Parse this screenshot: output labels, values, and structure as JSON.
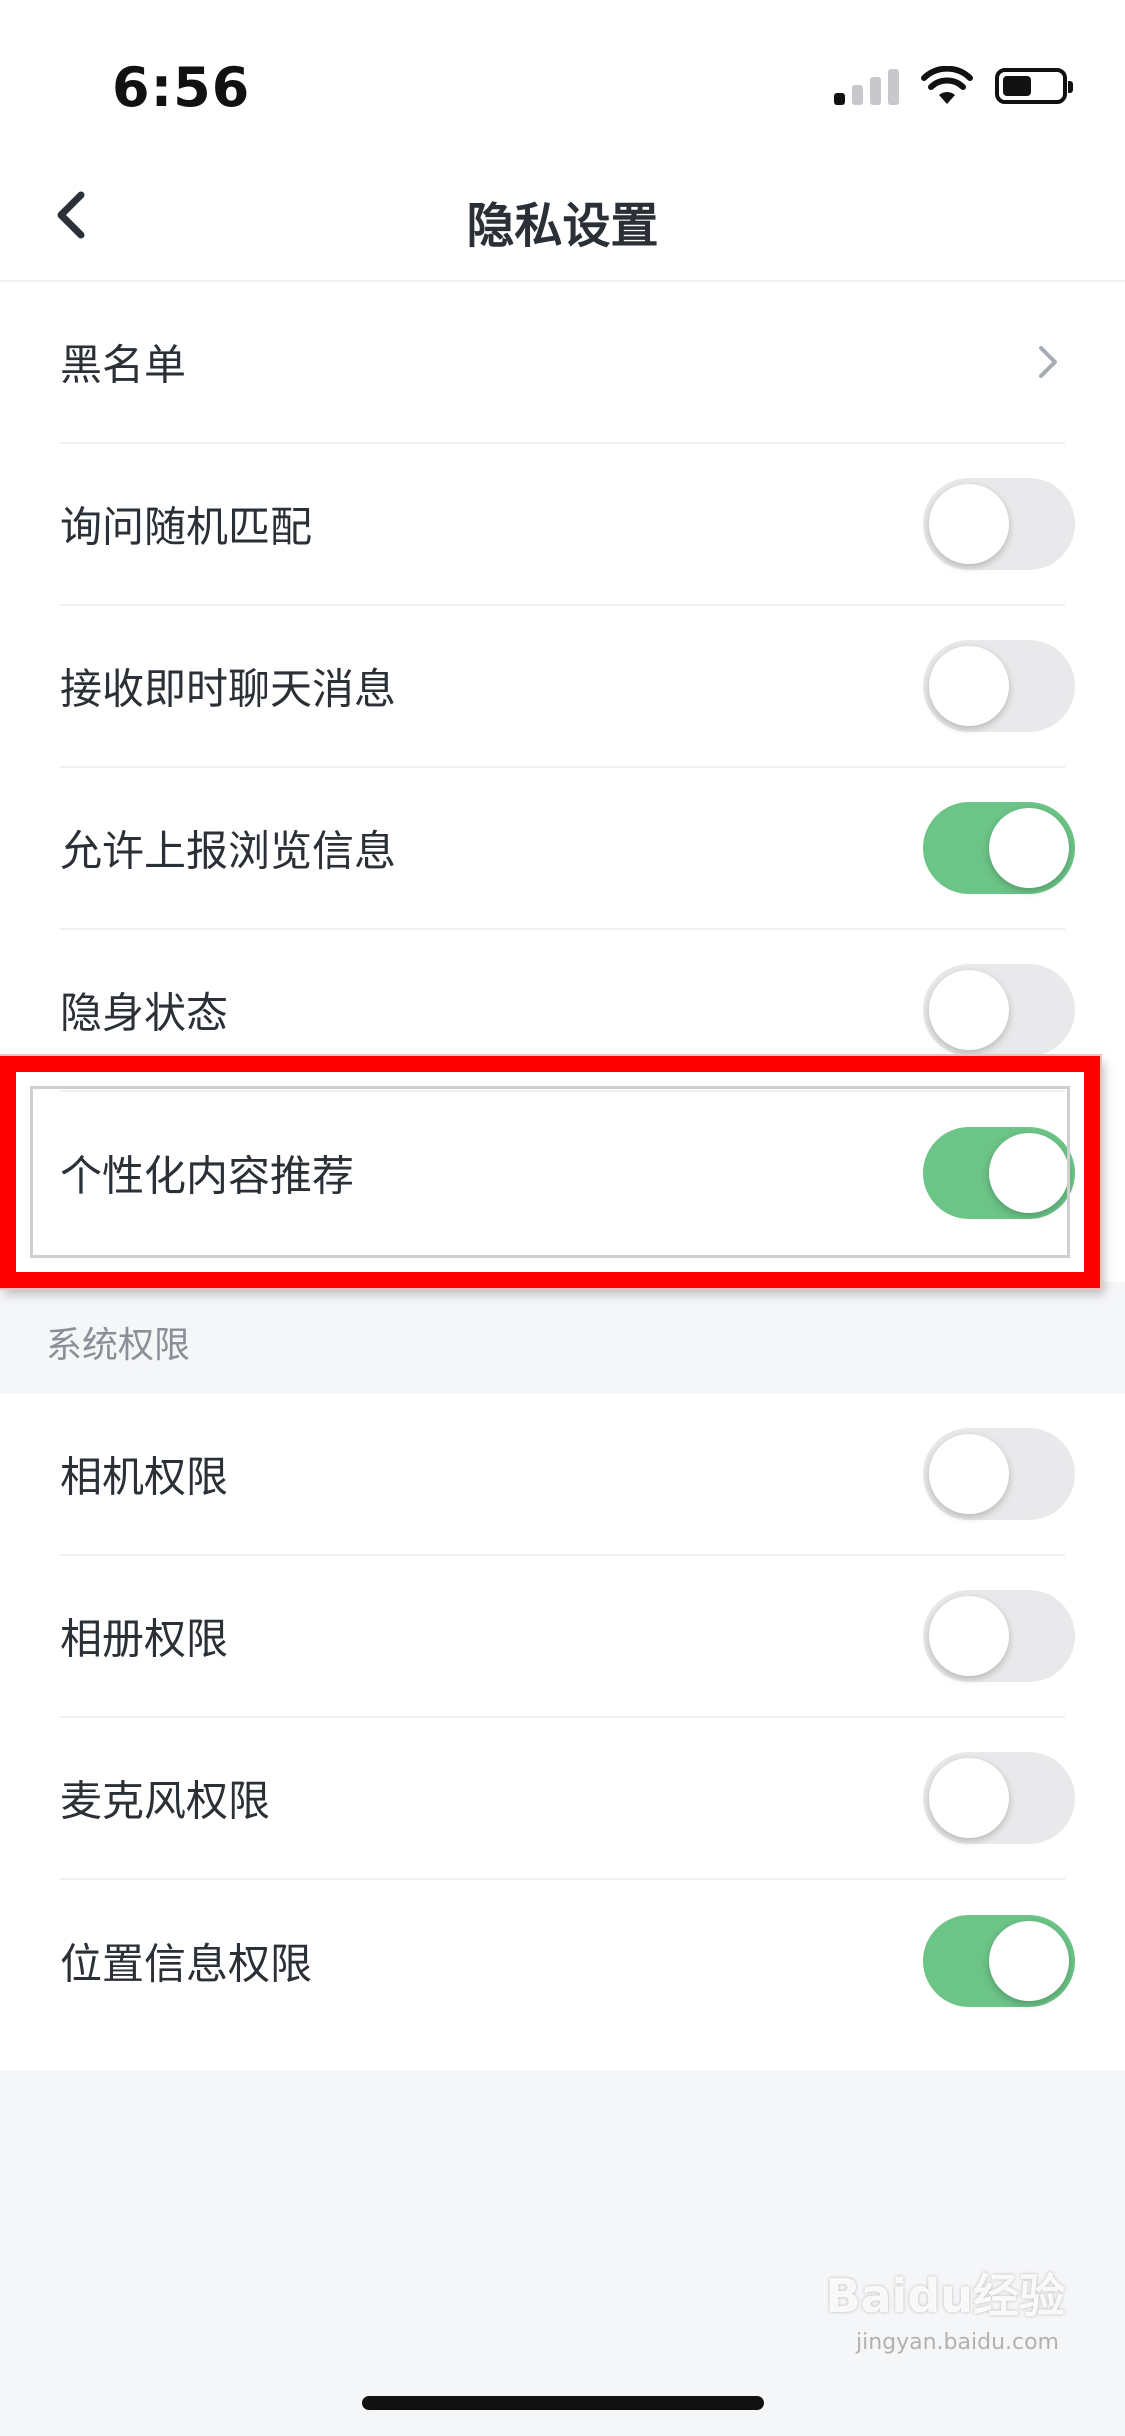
{
  "status_bar": {
    "time": "6:56"
  },
  "nav": {
    "title": "隐私设置"
  },
  "privacy": {
    "items": [
      {
        "label": "黑名单",
        "control": "chevron"
      },
      {
        "label": "询问随机匹配",
        "control": "toggle",
        "enabled": false
      },
      {
        "label": "接收即时聊天消息",
        "control": "toggle",
        "enabled": false
      },
      {
        "label": "允许上报浏览信息",
        "control": "toggle",
        "enabled": true
      },
      {
        "label": "隐身状态",
        "control": "toggle",
        "enabled": false
      },
      {
        "label": "个性化内容推荐",
        "control": "toggle",
        "enabled": true
      }
    ]
  },
  "system_section": {
    "title": "系统权限",
    "items": [
      {
        "label": "相机权限",
        "control": "toggle",
        "enabled": false
      },
      {
        "label": "相册权限",
        "control": "toggle",
        "enabled": false
      },
      {
        "label": "麦克风权限",
        "control": "toggle",
        "enabled": false
      },
      {
        "label": "位置信息权限",
        "control": "toggle",
        "enabled": true
      }
    ]
  },
  "watermark": {
    "text": "Baidu经验",
    "sub": "jingyan.baidu.com"
  },
  "colors": {
    "toggle_on": "#6cc487",
    "toggle_off": "#e9e9eb",
    "highlight": "#ff0000"
  }
}
